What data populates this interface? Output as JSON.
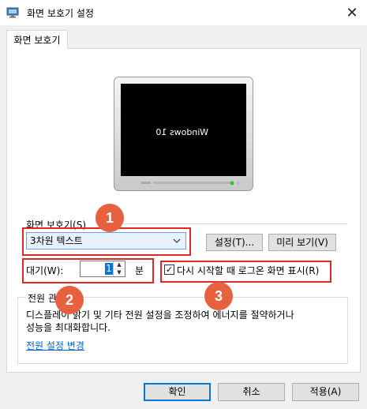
{
  "window": {
    "title": "화면 보호기 설정",
    "close_glyph": "✕"
  },
  "tab": {
    "label": "화면 보호기"
  },
  "preview": {
    "text": "Windows 10"
  },
  "screensaver": {
    "group_label": "화면 보호기(S)",
    "selected": "3차원 텍스트",
    "settings_button": "설정(T)...",
    "preview_button": "미리 보기(V)"
  },
  "wait": {
    "label": "대기(W):",
    "value": "1",
    "unit": "분"
  },
  "resume": {
    "checked": true,
    "label": "다시 시작할 때 로그온 화면 표시(R)"
  },
  "power": {
    "group_label": "전원 관",
    "description_line1": "디스플레이 밝기 및 기타 전원 설정을 조정하여 에너지를 절약하거나",
    "description_line2": "성능을 최대화합니다.",
    "link": "전원 설정 변경"
  },
  "footer": {
    "ok": "확인",
    "cancel": "취소",
    "apply": "적용(A)"
  },
  "annotations": {
    "badge1": "1",
    "badge2": "2",
    "badge3": "3"
  },
  "colors": {
    "highlight_red": "#e0282a",
    "badge_orange": "#e8613f",
    "accent_blue": "#0078d7",
    "link_blue": "#0066cc"
  }
}
